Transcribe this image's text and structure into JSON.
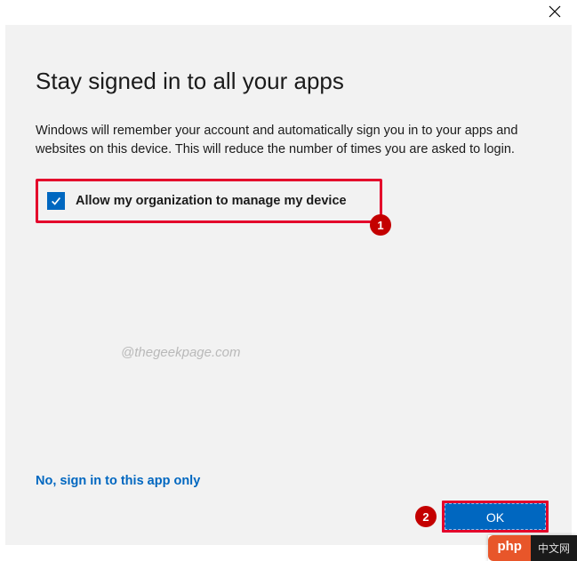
{
  "title": "Stay signed in to all your apps",
  "description": "Windows will remember your account and automatically sign you in to your apps and websites on this device. This will reduce the number of times you are asked to login.",
  "checkbox": {
    "label": "Allow my organization to manage my device",
    "checked": true
  },
  "callouts": {
    "one": "1",
    "two": "2"
  },
  "watermark": "@thegeekpage.com",
  "alt_link": "No, sign in to this app only",
  "ok_label": "OK",
  "badge": {
    "left": "php",
    "right": "中文网"
  }
}
